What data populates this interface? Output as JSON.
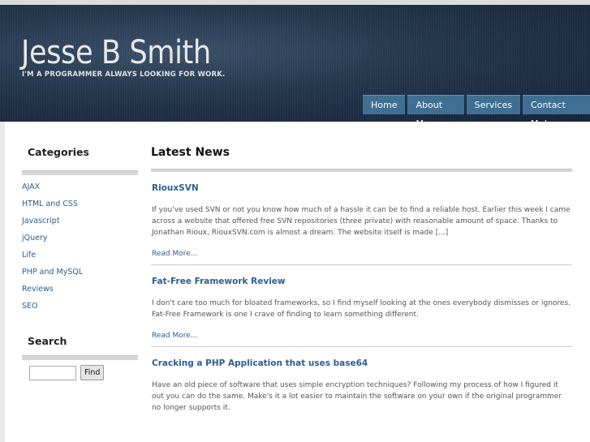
{
  "header": {
    "title": "Jesse B Smith",
    "tagline": "I'M A PROGRAMMER ALWAYS LOOKING FOR WORK."
  },
  "nav": [
    {
      "label": "Home"
    },
    {
      "label": "About Me"
    },
    {
      "label": "Services"
    },
    {
      "label": "Contact Me!"
    }
  ],
  "sidebar": {
    "categories_heading": "Categories",
    "categories": [
      {
        "label": "AJAX"
      },
      {
        "label": "HTML and CSS"
      },
      {
        "label": "Javascript"
      },
      {
        "label": "jQuery"
      },
      {
        "label": "Life"
      },
      {
        "label": "PHP and MySQL"
      },
      {
        "label": "Reviews"
      },
      {
        "label": "SEO"
      }
    ],
    "search_heading": "Search",
    "search_value": "",
    "find_label": "Find"
  },
  "main": {
    "heading": "Latest News",
    "posts": [
      {
        "title": "RiouxSVN",
        "body": "If you've used SVN or not you know how much of a hassle it can be to find a reliable host. Earlier this week I came across a website that offered free SVN repositories (three private) with reasonable amount of space. Thanks to Jonathan Rioux, RiouxSVN.com is almost a dream. The website itself is made [...]",
        "read_more": "Read More..."
      },
      {
        "title": "Fat-Free Framework Review",
        "body": "I don't care too much for bloated frameworks, so I find myself looking at the ones everybody dismisses or ignores. Fat-Free Framework is one I crave of finding to learn something different.",
        "read_more": "Read More..."
      },
      {
        "title": "Cracking a PHP Application that uses base64",
        "body": "Have an old piece of software that uses simple encryption techniques? Following my process of how I figured it out you can do the same. Make's it a lot easier to maintain the software on your own if the original programmer no longer supports it."
      }
    ]
  },
  "colors": {
    "link": "#2c5e90",
    "nav_button": "#3f6f92",
    "header_dark": "#14233a"
  }
}
